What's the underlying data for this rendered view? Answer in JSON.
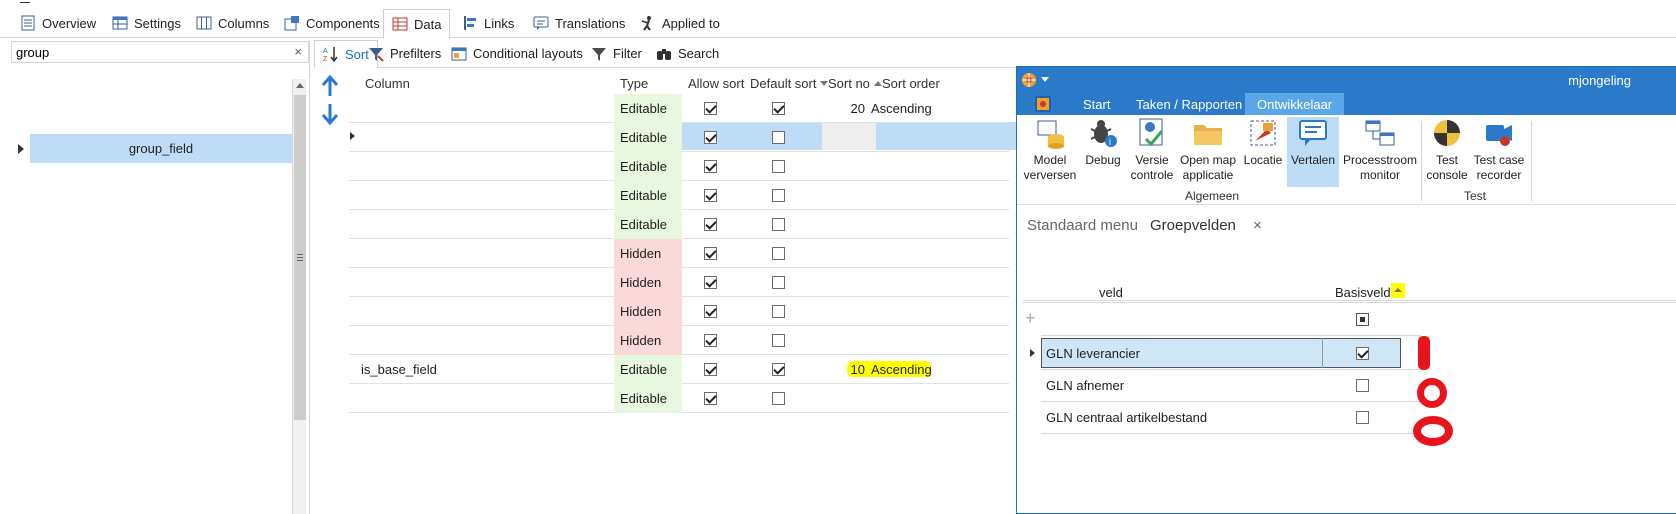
{
  "top_tabs": [
    {
      "label": "Overview",
      "icon": "overview-icon"
    },
    {
      "label": "Settings",
      "icon": "settings-grid-icon"
    },
    {
      "label": "Columns",
      "icon": "columns-icon"
    },
    {
      "label": "Components",
      "icon": "components-icon"
    },
    {
      "label": "Data",
      "icon": "data-table-icon",
      "active": true
    },
    {
      "label": "Links",
      "icon": "links-icon"
    },
    {
      "label": "Translations",
      "icon": "translations-icon"
    },
    {
      "label": "Applied to",
      "icon": "applied-to-icon"
    }
  ],
  "search": {
    "value": "group",
    "clear": "×"
  },
  "tree": {
    "selected_item": "group_field"
  },
  "sub_tabs": [
    {
      "label": "Sort",
      "icon": "sort-az-icon",
      "active": true
    },
    {
      "label": "Prefilters",
      "icon": "prefilter-icon"
    },
    {
      "label": "Conditional layouts",
      "icon": "conditional-layout-icon"
    },
    {
      "label": "Filter",
      "icon": "filter-icon"
    },
    {
      "label": "Search",
      "icon": "binoculars-icon"
    }
  ],
  "grid": {
    "headers": {
      "column": "Column",
      "type": "Type",
      "allow_sort": "Allow sort",
      "default_sort": "Default sort",
      "sort_no": "Sort no",
      "sort_order": "Sort order"
    },
    "rows": [
      {
        "column": "",
        "type": "Editable",
        "allow_sort": true,
        "default_sort": true,
        "sort_no": "20",
        "sort_order": "Ascending"
      },
      {
        "column": "",
        "type": "Editable",
        "allow_sort": true,
        "default_sort": false,
        "sort_no": "",
        "sort_order": "",
        "selected": true
      },
      {
        "column": "",
        "type": "Editable",
        "allow_sort": true,
        "default_sort": false,
        "sort_no": "",
        "sort_order": ""
      },
      {
        "column": "",
        "type": "Editable",
        "allow_sort": true,
        "default_sort": false,
        "sort_no": "",
        "sort_order": ""
      },
      {
        "column": "",
        "type": "Editable",
        "allow_sort": true,
        "default_sort": false,
        "sort_no": "",
        "sort_order": ""
      },
      {
        "column": "",
        "type": "Hidden",
        "allow_sort": true,
        "default_sort": false,
        "sort_no": "",
        "sort_order": ""
      },
      {
        "column": "",
        "type": "Hidden",
        "allow_sort": true,
        "default_sort": false,
        "sort_no": "",
        "sort_order": ""
      },
      {
        "column": "",
        "type": "Hidden",
        "allow_sort": true,
        "default_sort": false,
        "sort_no": "",
        "sort_order": ""
      },
      {
        "column": "",
        "type": "Hidden",
        "allow_sort": true,
        "default_sort": false,
        "sort_no": "",
        "sort_order": ""
      },
      {
        "column": "is_base_field",
        "type": "Editable",
        "allow_sort": true,
        "default_sort": true,
        "sort_no": "10",
        "sort_order": "Ascending",
        "highlight": true
      },
      {
        "column": "",
        "type": "Editable",
        "allow_sort": true,
        "default_sort": false,
        "sort_no": "",
        "sort_order": ""
      }
    ]
  },
  "window": {
    "user": "mjongeling",
    "ribbon_tabs": [
      "Start",
      "Taken / Rapporten",
      "Ontwikkelaar"
    ],
    "ribbon_buttons": [
      {
        "label": "Model verversen",
        "icon": "model-refresh-icon"
      },
      {
        "label": "Debug",
        "icon": "bug-icon"
      },
      {
        "label": "Versie controle",
        "icon": "version-control-icon"
      },
      {
        "label": "Open map applicatie",
        "icon": "folder-icon"
      },
      {
        "label": "Locatie",
        "icon": "location-icon"
      },
      {
        "label": "Vertalen",
        "icon": "translate-icon",
        "active": true
      },
      {
        "label": "Processtroom monitor",
        "icon": "process-monitor-icon"
      },
      {
        "label": "Test console",
        "icon": "test-console-icon"
      },
      {
        "label": "Test case recorder",
        "icon": "test-recorder-icon"
      }
    ],
    "ribbon_groups": [
      "Algemeen",
      "Test"
    ],
    "doc_tabs": [
      "Standaard menu",
      "Groepvelden"
    ],
    "doc_close": "×",
    "table": {
      "headers": {
        "veld": "veld",
        "basisveld": "Basisveld"
      },
      "add": "+",
      "rows": [
        {
          "veld": "GLN leverancier",
          "basisveld": true,
          "selected": true
        },
        {
          "veld": "GLN afnemer",
          "basisveld": false
        },
        {
          "veld": "GLN centraal artikelbestand",
          "basisveld": false
        }
      ]
    }
  },
  "colors": {
    "accent": "#2b7ac9",
    "selection": "#bfdcf7",
    "editable": "#e8f7df",
    "hidden": "#fbd9d9",
    "highlight": "#ffff00",
    "annotation": "#e8141b"
  }
}
